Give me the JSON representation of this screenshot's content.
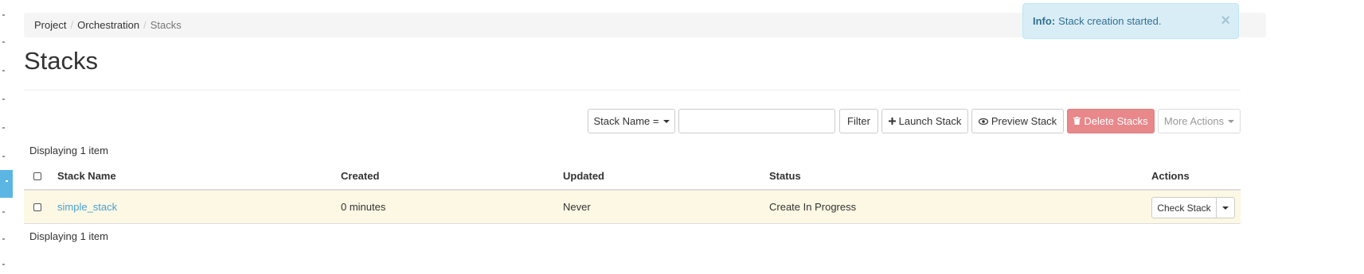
{
  "breadcrumb": {
    "items": [
      "Project",
      "Orchestration",
      "Stacks"
    ],
    "separator": "/"
  },
  "page": {
    "title": "Stacks"
  },
  "alert": {
    "label": "Info:",
    "message": "Stack creation started.",
    "close": "×"
  },
  "toolbar": {
    "filter_field": "Stack Name =",
    "filter_value": "",
    "filter_button": "Filter",
    "launch": "Launch Stack",
    "preview": "Preview Stack",
    "delete": "Delete Stacks",
    "more_actions": "More Actions"
  },
  "table": {
    "count_top": "Displaying 1 item",
    "count_bottom": "Displaying 1 item",
    "columns": [
      "Stack Name",
      "Created",
      "Updated",
      "Status",
      "Actions"
    ],
    "rows": [
      {
        "name": "simple_stack",
        "created": "0 minutes",
        "updated": "Never",
        "status": "Create In Progress",
        "action": "Check Stack"
      }
    ]
  },
  "icons": {
    "plus": "plus-icon",
    "eye": "eye-icon",
    "trash": "trash-icon",
    "close": "close-icon",
    "caret": "caret-down-icon"
  },
  "colors": {
    "danger": "#e8888b",
    "info_bg": "#d9edf7",
    "link": "#4a9fd5",
    "row_highlight": "#fcf8e3",
    "nav_active": "#5bb6e4"
  }
}
